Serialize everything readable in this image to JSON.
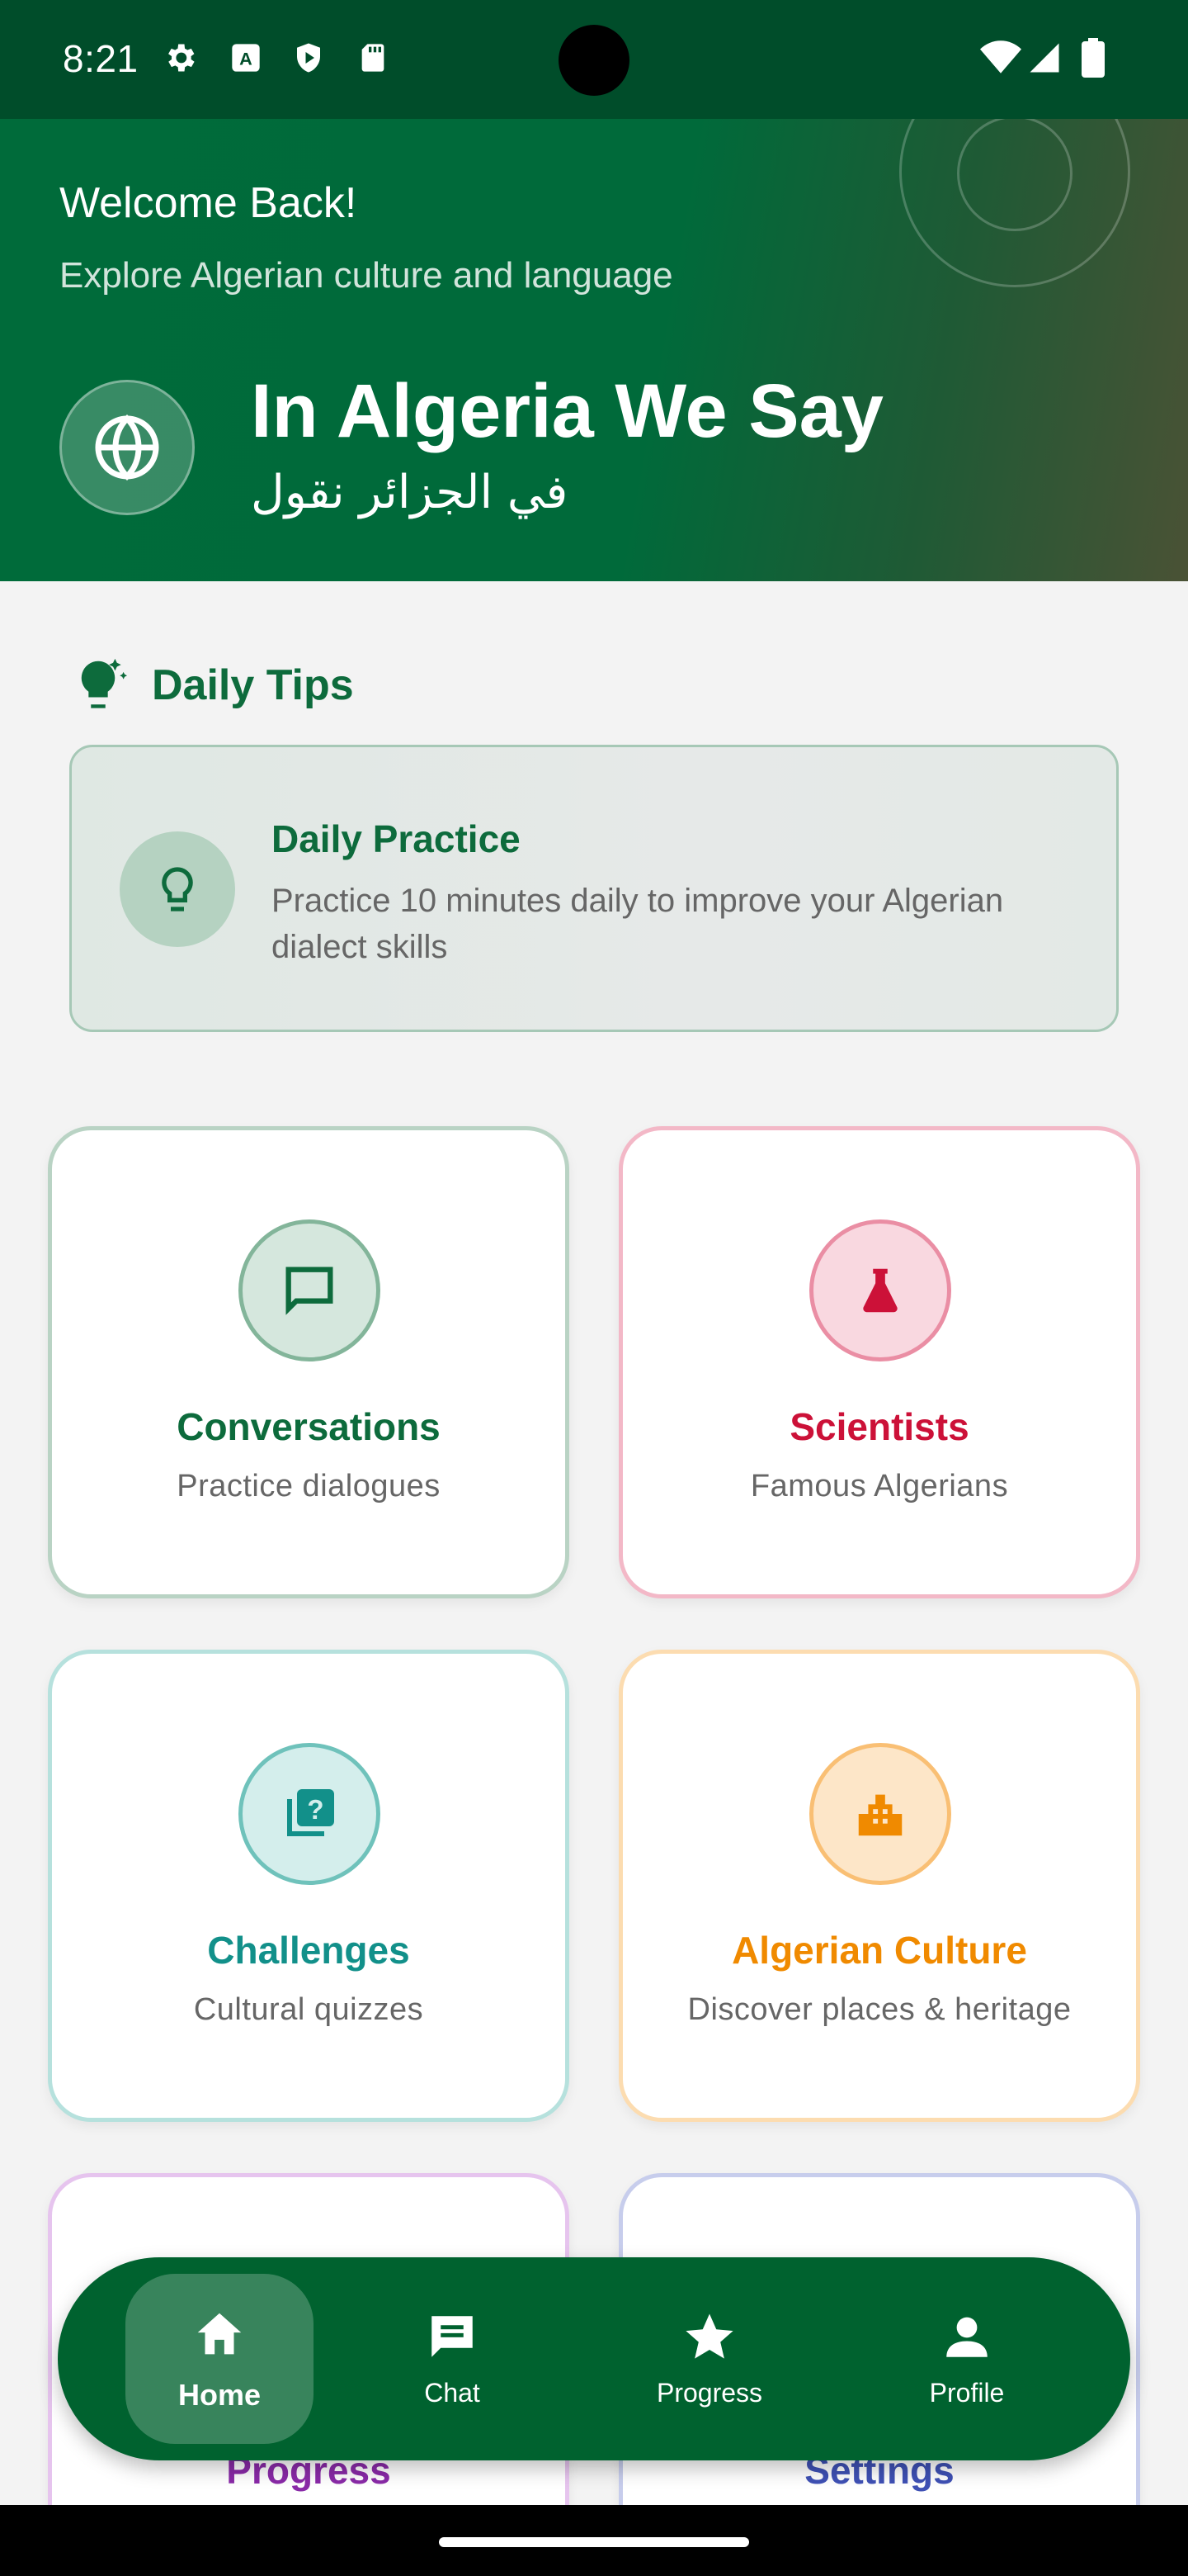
{
  "status_bar": {
    "time": "8:21"
  },
  "header": {
    "welcome": "Welcome Back!",
    "subtitle": "Explore Algerian culture and language",
    "app_title": "In Algeria We Say",
    "app_title_arabic": "في الجزائر نقول"
  },
  "daily_tips": {
    "heading": "Daily Tips",
    "card_title": "Daily Practice",
    "card_text": "Practice 10 minutes daily to improve your Algerian dialect skills"
  },
  "cards": [
    {
      "title": "Conversations",
      "subtitle": "Practice dialogues",
      "color": "#0d6b3c",
      "icon": "chat-bubble-icon"
    },
    {
      "title": "Scientists",
      "subtitle": "Famous Algerians",
      "color": "#cc1138",
      "icon": "flask-icon"
    },
    {
      "title": "Challenges",
      "subtitle": "Cultural quizzes",
      "color": "#12908a",
      "icon": "quiz-icon"
    },
    {
      "title": "Algerian Culture",
      "subtitle": "Discover places & heritage",
      "color": "#f08a00",
      "icon": "city-icon"
    },
    {
      "title": "Progress",
      "subtitle": "",
      "color": "#8a2aa8",
      "icon": "trend-icon"
    },
    {
      "title": "Settings",
      "subtitle": "",
      "color": "#3f51b5",
      "icon": "gear-icon"
    }
  ],
  "bottom_nav": {
    "active": "Home",
    "items": [
      {
        "label": "Home",
        "icon": "home-icon"
      },
      {
        "label": "Chat",
        "icon": "chat-icon"
      },
      {
        "label": "Progress",
        "icon": "star-icon"
      },
      {
        "label": "Profile",
        "icon": "person-icon"
      }
    ]
  },
  "colors": {
    "primary": "#00622f",
    "header": "#006b3a",
    "background": "#f3f3f3"
  }
}
